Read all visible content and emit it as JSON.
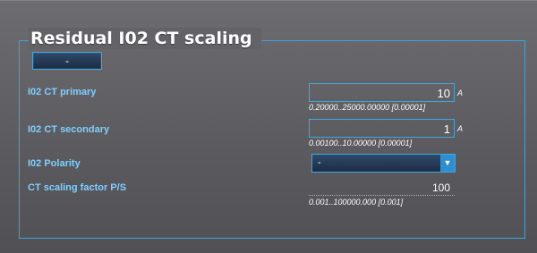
{
  "group": {
    "title": "Residual I02 CT scaling",
    "action_label": "-"
  },
  "fields": {
    "primary": {
      "label": "I02 CT primary",
      "value": "10",
      "unit": "A",
      "range": "0.20000..25000.00000 [0.00001]"
    },
    "secondary": {
      "label": "I02 CT secondary",
      "value": "1",
      "unit": "A",
      "range": "0.00100..10.00000 [0.00001]"
    },
    "polarity": {
      "label": "I02 Polarity",
      "selected": "-"
    },
    "scaling_factor": {
      "label": "CT scaling factor P/S",
      "value": "100",
      "range": "0.001..100000.000 [0.001]"
    }
  },
  "colors": {
    "accent": "#3ea9de",
    "label": "#7fd0ff",
    "text": "#ffffff"
  },
  "icons": {
    "dropdown": "chevron-down-icon"
  }
}
